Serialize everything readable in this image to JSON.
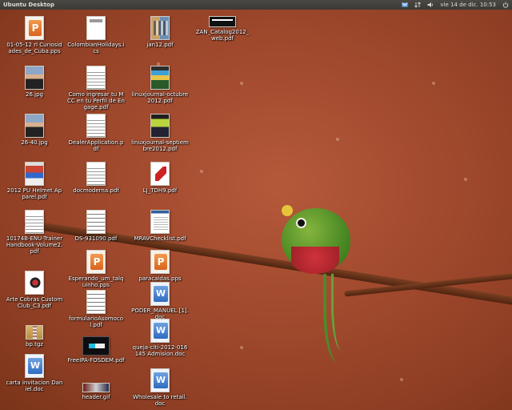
{
  "topbar": {
    "title": "Ubuntu Desktop",
    "clock": "vie 14 de dic. 10:53",
    "tray_icons": [
      "mail-icon",
      "network-icon",
      "volume-icon",
      "power-icon"
    ]
  },
  "icons": [
    {
      "label": "01-05-12 rl Curiosidades_de_Cuba.pps",
      "kind": "pps"
    },
    {
      "label": "ColombianHolidays.ics",
      "kind": "ics"
    },
    {
      "label": "jan12.pdf",
      "kind": "jan"
    },
    {
      "label": "ZAN_Catalog2012_web.pdf",
      "kind": "wide"
    },
    {
      "label": "26.jpg",
      "kind": "photo"
    },
    {
      "label": "Como ingresar tu MCC en tu Perfil de Engage.pdf",
      "kind": "lines"
    },
    {
      "label": "linuxjournal-octubre2012.pdf",
      "kind": "mag"
    },
    {
      "label": "26-40.jpg",
      "kind": "photo"
    },
    {
      "label": "DealerApplication.pdf",
      "kind": "lines"
    },
    {
      "label": "linuxjournal-septiembre2012.pdf",
      "kind": "mag2"
    },
    {
      "label": "2012 PU Helmet Apparel.pdf",
      "kind": "mag3"
    },
    {
      "label": "docmoderna.pdf",
      "kind": "lines"
    },
    {
      "label": "LJ_TDH9.pdf",
      "kind": "acro"
    },
    {
      "label": "10174B-ENU-TrainerHandbook-Volume2.pdf",
      "kind": "lines"
    },
    {
      "label": "DS-931090.pdf",
      "kind": "form"
    },
    {
      "label": "MRAVChecklist.pdf",
      "kind": "checklist"
    },
    {
      "label": "Esperando_um_talquinho.pps",
      "kind": "pps"
    },
    {
      "label": "paracaidas.pps",
      "kind": "pps"
    },
    {
      "label": "Arte Cobras Custom Club_C3.pdf",
      "kind": "crest"
    },
    {
      "label": "formularioAsomocol.pdf",
      "kind": "form"
    },
    {
      "label": "PODER_MANUEL [1].doc",
      "kind": "doc"
    },
    {
      "label": "bp.tgz",
      "kind": "tgz"
    },
    {
      "label": "queja-citi-2012-016145 Admision.doc",
      "kind": "doc"
    },
    {
      "label": "FreeIPA-FOSDEM.pdf",
      "kind": "dark"
    },
    {
      "label": "carta invitacion Daniel.doc",
      "kind": "doc"
    },
    {
      "label": "header.gif",
      "kind": "gif"
    },
    {
      "label": "Wholesale to retail.doc",
      "kind": "doc"
    }
  ]
}
